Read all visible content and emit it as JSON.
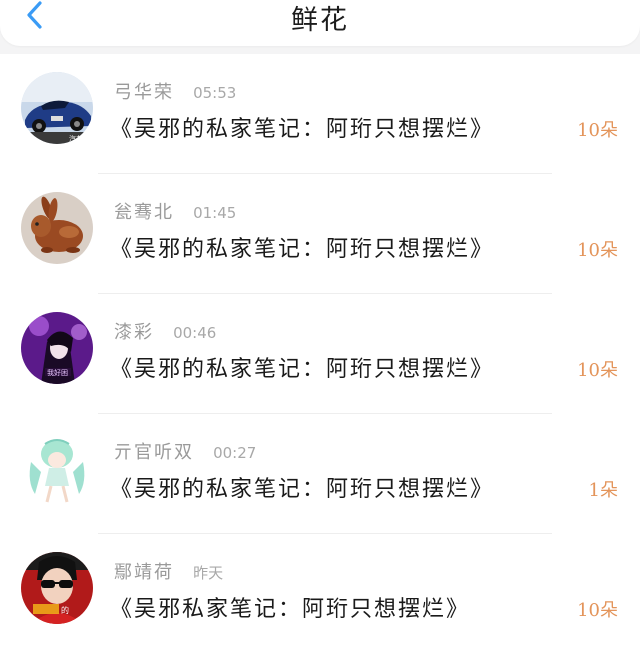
{
  "header": {
    "title": "鲜花",
    "back_icon": "chevron-left-icon",
    "accent_color": "#3a9bf5"
  },
  "amount_color": "#e3945a",
  "items": [
    {
      "username": "弓华荣",
      "time": "05:53",
      "book": "《吴邪的私家笔记：阿珩只想摆烂》",
      "amount": "10朵",
      "avatar": "sports-car-avatar"
    },
    {
      "username": "瓮骞北",
      "time": "01:45",
      "book": "《吴邪的私家笔记：阿珩只想摆烂》",
      "amount": "10朵",
      "avatar": "rabbit-avatar"
    },
    {
      "username": "漆彩",
      "time": "00:46",
      "book": "《吴邪的私家笔记：阿珩只想摆烂》",
      "amount": "10朵",
      "avatar": "purple-anime-avatar"
    },
    {
      "username": "亓官听双",
      "time": "00:27",
      "book": "《吴邪的私家笔记：阿珩只想摆烂》",
      "amount": "1朵",
      "avatar": "green-hair-anime-avatar"
    },
    {
      "username": "鄢靖荷",
      "time": "昨天",
      "book": "《吴邪私家笔记：阿珩只想摆烂》",
      "amount": "10朵",
      "avatar": "sunglasses-man-avatar"
    }
  ]
}
